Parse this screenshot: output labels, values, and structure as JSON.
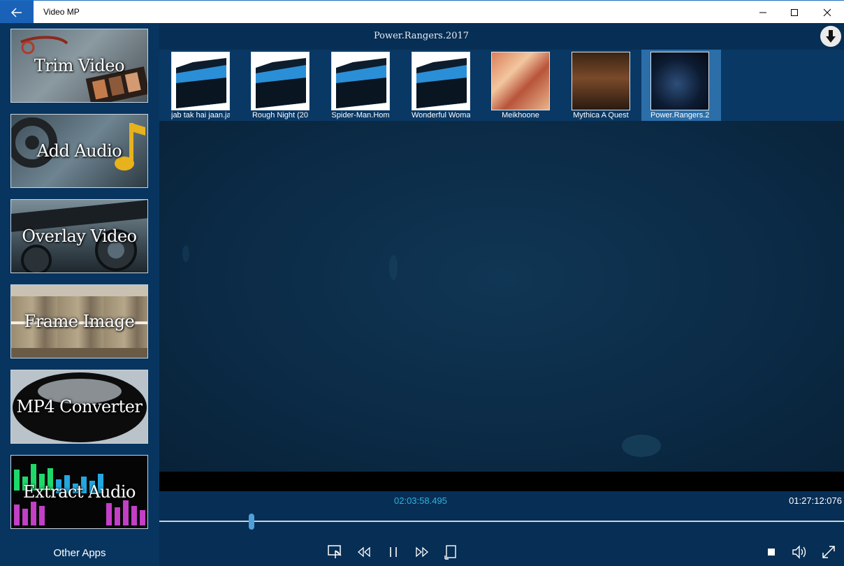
{
  "window": {
    "title": "Video MP"
  },
  "sidebar": {
    "tiles": [
      {
        "label": "Trim Video"
      },
      {
        "label": "Add Audio"
      },
      {
        "label": "Overlay Video"
      },
      {
        "label": "Frame Image"
      },
      {
        "label": "MP4 Converter"
      },
      {
        "label": "Extract Audio"
      }
    ],
    "other_apps": "Other Apps"
  },
  "player": {
    "now_playing": "Power.Rangers.2017",
    "current_time": "02:03:58.495",
    "total_time": "01:27:12:076",
    "progress": 0.135
  },
  "playlist": [
    {
      "name": "jab tak hai jaan.ja",
      "type": "folder"
    },
    {
      "name": "Rough Night (20",
      "type": "folder"
    },
    {
      "name": "Spider-Man.Hom",
      "type": "folder"
    },
    {
      "name": "Wonderful Woma",
      "type": "folder"
    },
    {
      "name": "Meikhoone",
      "type": "poster"
    },
    {
      "name": "Mythica A Quest",
      "type": "poster"
    },
    {
      "name": "Power.Rangers.2(",
      "type": "poster",
      "selected": true
    }
  ],
  "colors": {
    "titlebar_back": "#1a62b8",
    "sidebar_bg": "#08355f",
    "main_bg": "#072e54",
    "accent_time": "#2eb2e0",
    "selected_thumb": "#2b6ea8"
  },
  "icons": {
    "back": "back-arrow-icon",
    "minimize": "minimize-icon",
    "maximize": "maximize-icon",
    "close": "close-icon",
    "download": "download-icon",
    "screenshot": "screenshot-icon",
    "rewind": "rewind-icon",
    "pause": "pause-icon",
    "fast_forward": "fast-forward-icon",
    "rotate": "rotate-icon",
    "stop": "stop-icon",
    "volume": "volume-icon",
    "fullscreen": "fullscreen-icon"
  }
}
